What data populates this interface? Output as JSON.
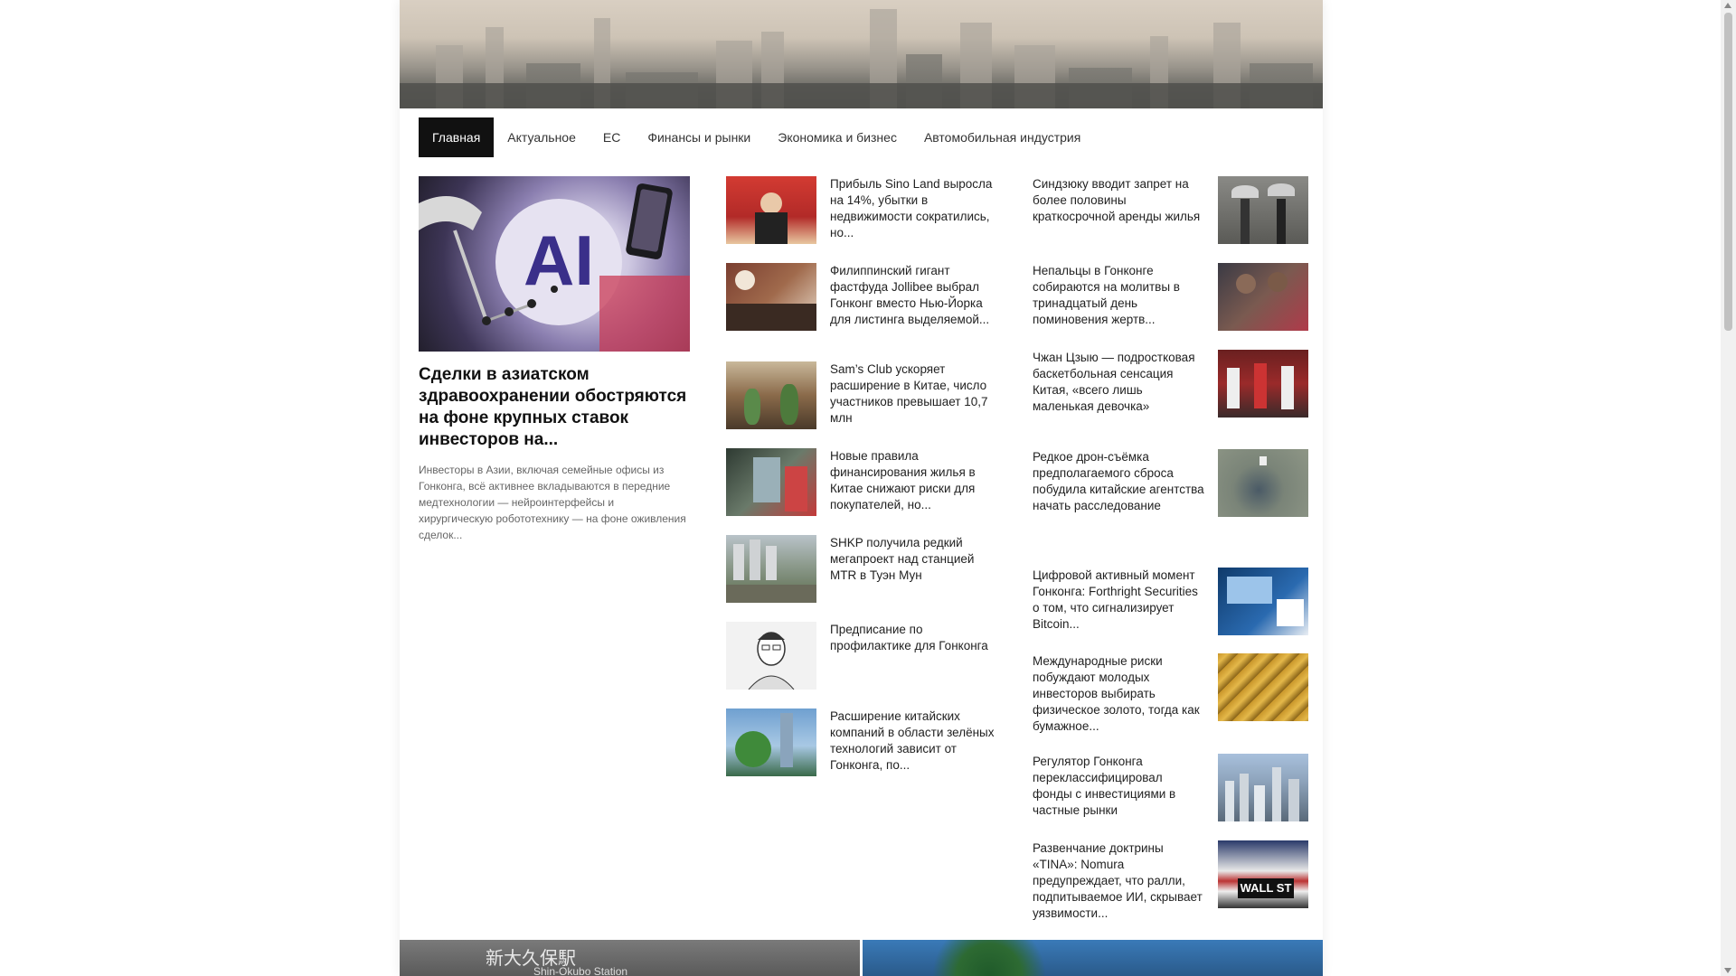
{
  "nav": {
    "items": [
      {
        "label": "Главная",
        "active": true
      },
      {
        "label": "Актуальное",
        "active": false
      },
      {
        "label": "ЕС",
        "active": false
      },
      {
        "label": "Финансы и рынки",
        "active": false
      },
      {
        "label": "Экономика и бизнес",
        "active": false
      },
      {
        "label": "Автомобильная индустрия",
        "active": false
      }
    ]
  },
  "feature": {
    "image_text": "AI",
    "title": "Сделки в азиатском здравоохранении обостряются на фоне крупных ставок инвесторов на...",
    "description": "Инвесторы в Азии, включая семейные офисы из Гонконга, всё активнее вкладываются в передние медтехнологии — нейроинтерфейсы и хирургическую робототехнику — на фоне оживления сделок..."
  },
  "middle_column": [
    {
      "title": "Прибыль Sino Land выросла на 14%, убытки в недвижимости сократились, но...",
      "thumb_color": "#c8322c"
    },
    {
      "title": "Филиппинский гигант фастфуда Jollibee выбрал Гонконг вместо Нью-Йорка для листинга выделяемой...",
      "thumb_color": "#6d4a3a"
    },
    {
      "title": "Sam’s Club ускоряет расширение в Китае, число участников превышает 10,7 млн",
      "thumb_color": "#7a6048"
    },
    {
      "title": "Новые правила финансирования жилья в Китае снижают риски для покупателей, но...",
      "thumb_color": "#4a5a4a"
    },
    {
      "title": "SHKP получила редкий мегапроект над станцией MTR в Туэн Мун",
      "thumb_color": "#7d8a78"
    },
    {
      "title": "Предписание по профилактике для Гонконга",
      "thumb_color": "#e8e8e8"
    },
    {
      "title": "Расширение китайских компаний в области зелёных технологий зависит от Гонконга, по...",
      "thumb_color": "#5b8ab0"
    }
  ],
  "right_column": [
    {
      "title": "Синдзюку вводит запрет на более половины краткосрочной аренды жилья",
      "thumb_color": "#6a6a66"
    },
    {
      "title": "Непальцы в Гонконге собираются на молитвы в тринадцатый день поминовения жертв...",
      "thumb_color": "#5a4a44"
    },
    {
      "title": "Чжан Цзыю — подростковая баскетбольная сенсация Китая, «всего лишь маленькая девочка»",
      "thumb_color": "#8a2a2a"
    },
    {
      "title": "Редкое дрон-съёмка предполагаемого сброса побудила китайские агентства начать расследование",
      "thumb_color": "#7a8478"
    },
    {
      "title": "Цифровой активный момент Гонконга: Forthright Securities о том, что сигнализирует Bitcoin...",
      "thumb_color": "#1f4f8a"
    },
    {
      "title": "Международные риски побуждают молодых инвесторов выбирать физическое золото, тогда как бумажное...",
      "thumb_color": "#a07820"
    },
    {
      "title": "Регулятор Гонконга переклассифицировал фонды с инвестициями в частные рынки",
      "thumb_color": "#7a90a8"
    },
    {
      "title": "Развенчание доктрины «TINA»: Nomura предупреждает, что ралли, подпитываемое ИИ, скрывает уязвимости...",
      "thumb_color": "#4a4a4a"
    }
  ],
  "bottom": {
    "left_sign": "新大久保駅",
    "left_sign_sub": "Shin-Okubo Station"
  },
  "colors": {
    "nav_active_bg": "#111111",
    "text": "#222222",
    "muted": "#666666"
  }
}
